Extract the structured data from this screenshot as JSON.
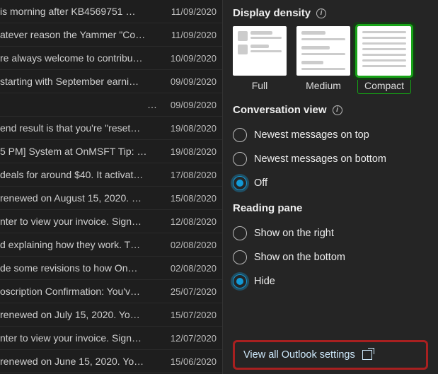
{
  "mail_list": {
    "rows": [
      {
        "subject": "is morning after KB4569751 …",
        "date": "11/09/2020"
      },
      {
        "subject": "atever reason the Yammer \"Co…",
        "date": "11/09/2020"
      },
      {
        "subject": "re always welcome to contribu…",
        "date": "10/09/2020"
      },
      {
        "subject": "starting with September earni…",
        "date": "09/09/2020"
      },
      {
        "subject": "…",
        "date": "09/09/2020"
      },
      {
        "subject": "end result is that you're \"reset…",
        "date": "19/08/2020"
      },
      {
        "subject": "5 PM] System at OnMSFT Tip: …",
        "date": "19/08/2020"
      },
      {
        "subject": "deals for around $40. It activat…",
        "date": "17/08/2020"
      },
      {
        "subject": " renewed on August 15, 2020. …",
        "date": "15/08/2020"
      },
      {
        "subject": "nter to view your invoice. Sign…",
        "date": "12/08/2020"
      },
      {
        "subject": "d explaining how they work. T…",
        "date": "02/08/2020"
      },
      {
        "subject": "de some revisions to how On…",
        "date": "02/08/2020"
      },
      {
        "subject": "oscription Confirmation: You'v…",
        "date": "25/07/2020"
      },
      {
        "subject": " renewed on July 15, 2020. Yo…",
        "date": "15/07/2020"
      },
      {
        "subject": "nter to view your invoice. Sign…",
        "date": "12/07/2020"
      },
      {
        "subject": " renewed on June 15, 2020. Yo…",
        "date": "15/06/2020"
      }
    ]
  },
  "settings": {
    "density": {
      "title": "Display density",
      "options": [
        {
          "label": "Full",
          "selected": false
        },
        {
          "label": "Medium",
          "selected": false
        },
        {
          "label": "Compact",
          "selected": true
        }
      ]
    },
    "conversation": {
      "title": "Conversation view",
      "options": [
        {
          "label": "Newest messages on top",
          "checked": false
        },
        {
          "label": "Newest messages on bottom",
          "checked": false
        },
        {
          "label": "Off",
          "checked": true
        }
      ]
    },
    "reading_pane": {
      "title": "Reading pane",
      "options": [
        {
          "label": "Show on the right",
          "checked": false
        },
        {
          "label": "Show on the bottom",
          "checked": false
        },
        {
          "label": "Hide",
          "checked": true
        }
      ]
    },
    "view_all_label": "View all Outlook settings"
  }
}
